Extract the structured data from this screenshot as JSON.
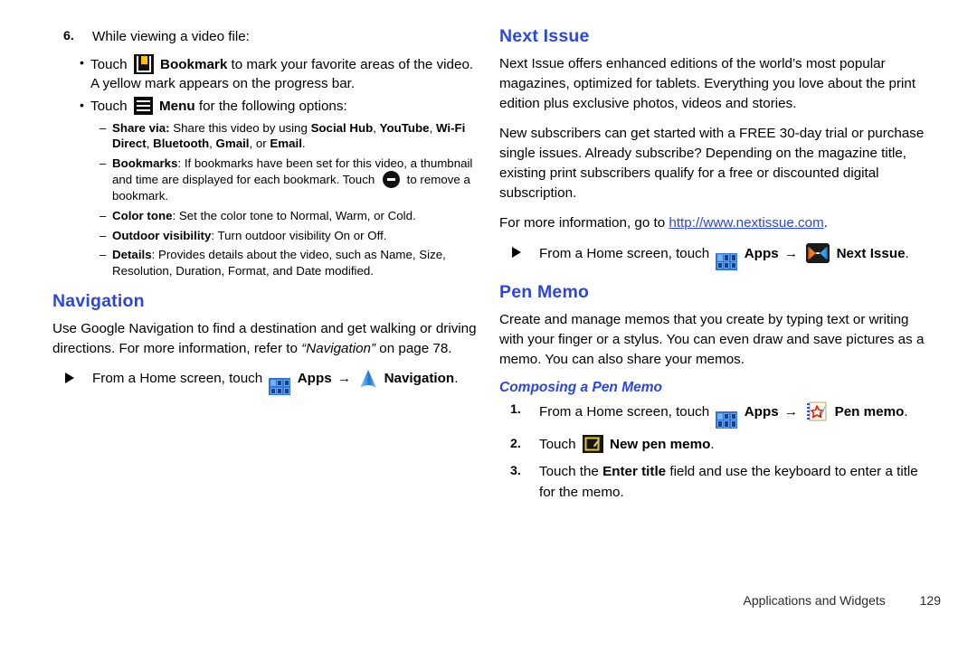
{
  "document": {
    "footer": {
      "section_title": "Applications and Widgets",
      "page_number": "129"
    },
    "colors": {
      "heading_blue": "#2b46e3",
      "link_blue": "#2b46e3",
      "text_black": "#000000",
      "bookmark_yellow": "#f5c414",
      "apps_blue": "#2f76d6"
    }
  },
  "left_column": {
    "step6": {
      "number": "6.",
      "text": "While viewing a video file:"
    },
    "bullet_bookmark": {
      "lead": "Touch",
      "icon": "bookmark-icon",
      "bold_label": "Bookmark",
      "rest": "to mark your favorite areas of the video. A yellow mark appears on the progress bar."
    },
    "bullet_menu": {
      "lead": "Touch",
      "icon": "menu-icon",
      "bold_label": "Menu",
      "rest": "for the following options:"
    },
    "options": {
      "share_via": {
        "label": "Share via:",
        "text_before": "Share this video by using",
        "items": [
          "Social Hub",
          "YouTube",
          "Wi-Fi Direct",
          "Bluetooth",
          "Gmail"
        ],
        "last_item": "Email",
        "conjunction": "or"
      },
      "bookmarks": {
        "label": "Bookmarks",
        "text_part1": ": If bookmarks have been set for this video, a thumbnail and time are displayed for each bookmark. Touch",
        "icon": "remove-bookmark-icon",
        "text_part2": "to remove a bookmark."
      },
      "color_tone": {
        "label": "Color tone",
        "text": ": Set the color tone to Normal, Warm, or Cold."
      },
      "outdoor_visibility": {
        "label": "Outdoor visibility",
        "text": ": Turn outdoor visibility On or Off."
      },
      "details": {
        "label": "Details",
        "text": ": Provides details about the video, such as Name, Size, Resolution, Duration, Format, and Date modified."
      }
    },
    "navigation_section": {
      "heading": "Navigation",
      "paragraph_part1": "Use Google Navigation to find a destination and get walking or driving directions. For more information, refer to ",
      "paragraph_italic": "“Navigation”",
      "paragraph_part2": " on page 78.",
      "instruction": {
        "lead": "From a Home screen, touch",
        "apps_icon": "apps-grid-icon",
        "apps_label": "Apps",
        "arrow": "→",
        "app_icon": "navigation-icon",
        "app_label": "Navigation",
        "period": "."
      }
    }
  },
  "right_column": {
    "next_issue_section": {
      "heading": "Next Issue",
      "paragraph1": "Next Issue offers enhanced editions of the world’s most popular magazines, optimized for tablets. Everything you love about the print edition plus exclusive photos, videos and stories.",
      "paragraph2": "New subscribers can get started with a FREE 30-day trial or purchase single issues. Already subscribe? Depending on the magazine title, existing print subscribers qualify for a free or discounted digital subscription.",
      "paragraph3_lead": "For more information, go to ",
      "paragraph3_link": "http://www.nextissue.com",
      "paragraph3_tail": ".",
      "instruction": {
        "lead": "From a Home screen, touch",
        "apps_icon": "apps-grid-icon",
        "apps_label": "Apps",
        "arrow": "→",
        "app_icon": "next-issue-icon",
        "app_label": "Next Issue",
        "period": "."
      }
    },
    "pen_memo_section": {
      "heading": "Pen Memo",
      "paragraph1": "Create and manage memos that you create by typing text or writing with your finger or a stylus. You can even draw and save pictures as a memo. You can also share your memos.",
      "subheading": "Composing a Pen Memo",
      "steps": {
        "step1": {
          "number": "1.",
          "lead": "From a Home screen, touch",
          "apps_icon": "apps-grid-icon",
          "apps_label": "Apps",
          "arrow": "→",
          "app_icon": "pen-memo-icon",
          "app_label": "Pen memo",
          "period": "."
        },
        "step2": {
          "number": "2.",
          "lead": "Touch",
          "icon": "new-pen-memo-icon",
          "bold_label": "New pen memo",
          "period": "."
        },
        "step3": {
          "number": "3.",
          "text_part1": "Touch the ",
          "bold_field": "Enter title",
          "text_part2": " field and use the keyboard to enter a title for the memo."
        }
      }
    }
  }
}
